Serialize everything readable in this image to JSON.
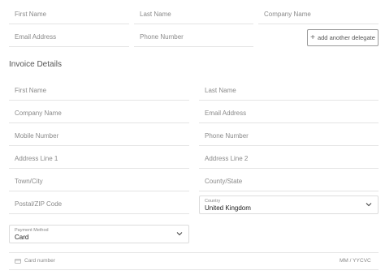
{
  "delegate": {
    "first_name_placeholder": "First Name",
    "last_name_placeholder": "Last Name",
    "company_name_placeholder": "Company Name",
    "email_placeholder": "Email Address",
    "phone_placeholder": "Phone Number",
    "add_delegate_label": "add another delegate"
  },
  "invoice": {
    "section_title": "Invoice Details",
    "first_name_placeholder": "First Name",
    "last_name_placeholder": "Last Name",
    "company_name_placeholder": "Company Name",
    "email_placeholder": "Email Address",
    "mobile_placeholder": "Mobile Number",
    "phone_placeholder": "Phone Number",
    "address1_placeholder": "Address Line 1",
    "address2_placeholder": "Address Line 2",
    "town_placeholder": "Town/City",
    "county_placeholder": "County/State",
    "postal_placeholder": "Postal/ZIP Code",
    "country_label": "Country",
    "country_value": "United Kingdom"
  },
  "payment": {
    "method_label": "Payment Method",
    "method_value": "Card",
    "card_number_placeholder": "Card number",
    "expiry_placeholder": "MM / YY",
    "cvc_placeholder": "CVC"
  },
  "icons": {
    "add": "plus-icon",
    "dropdown": "chevron-down-icon",
    "card": "credit-card-icon"
  },
  "colors": {
    "field_border": "#e4e4e4",
    "placeholder_text": "#8a8a8a",
    "button_border": "#9a9a9a"
  }
}
